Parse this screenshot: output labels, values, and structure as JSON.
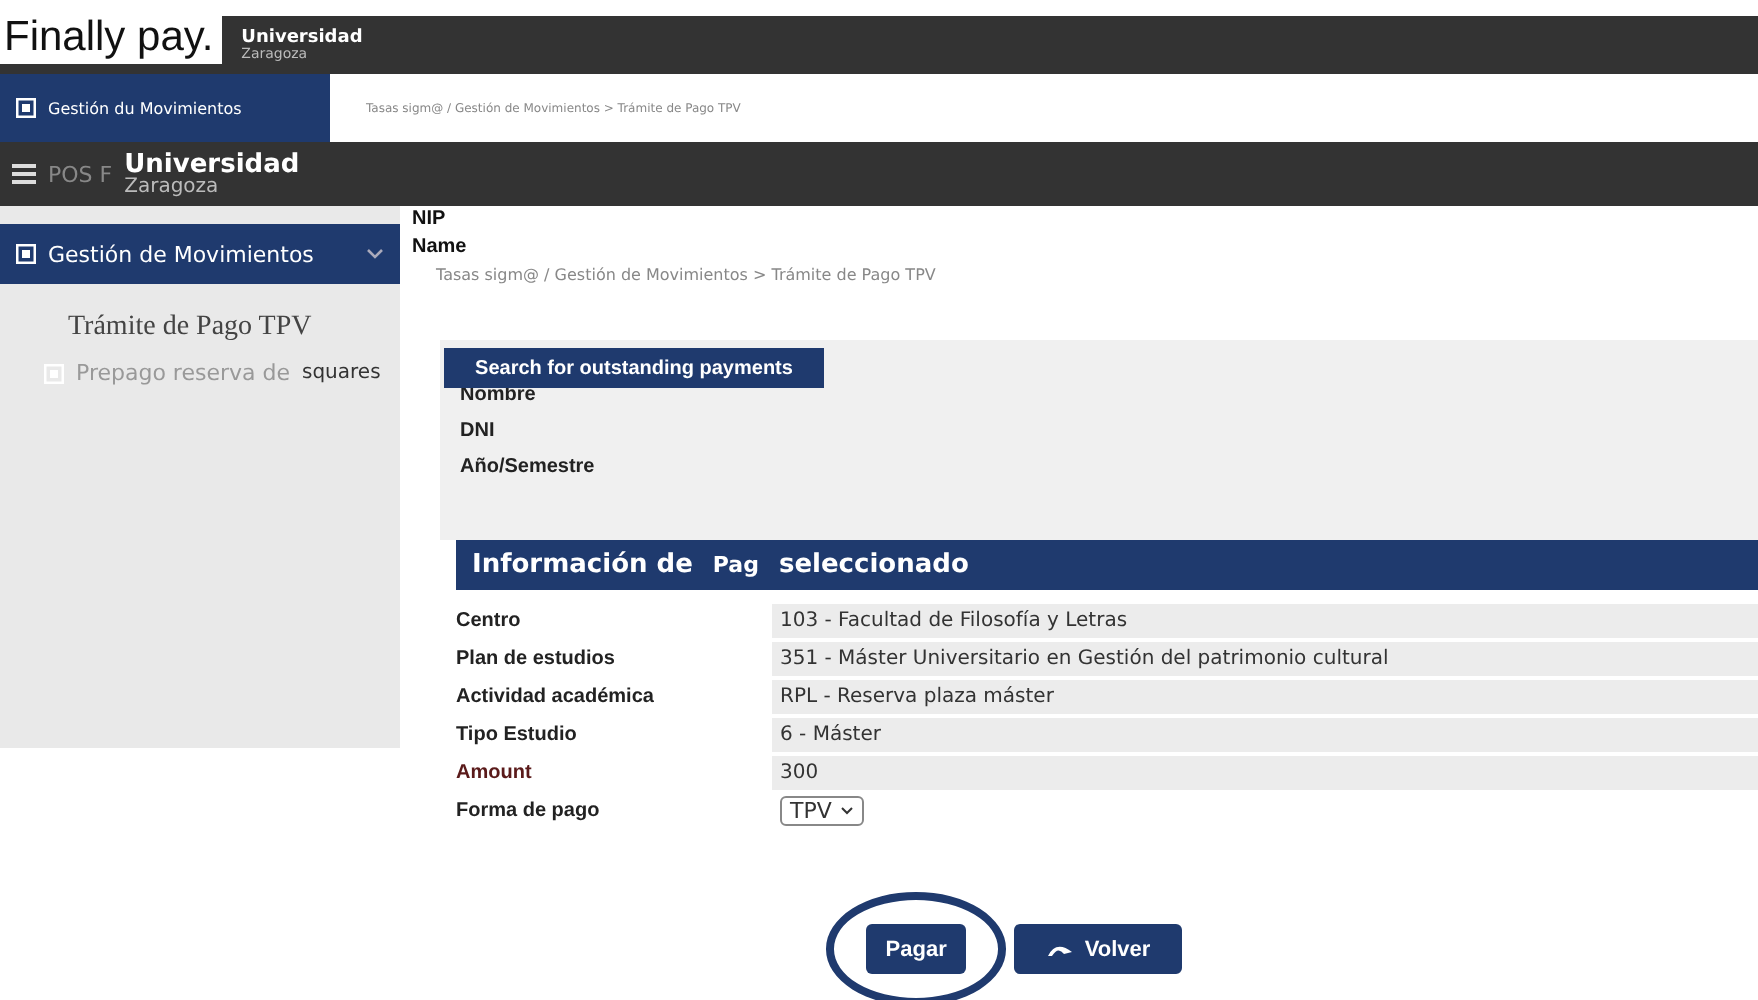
{
  "caption": "Finally pay.",
  "top_bar": {
    "logo_line_1": "Universidad",
    "logo_line_2": "Zaragoza"
  },
  "back_strip": {
    "menu_item": {
      "label": "Gestión du Movimientos",
      "selected": true
    },
    "breadcrumb": "Tasas sigm@ / Gestión de Movimientos > Trámite de Pago TPV"
  },
  "header": {
    "app_label": "POS F",
    "logo_line_1": "Universidad",
    "logo_line_2": "Zaragoza"
  },
  "overlay_labels": [
    "NIP",
    "Name"
  ],
  "sidebar": {
    "items": [
      {
        "label": "Gestión de Movimientos",
        "selected": true,
        "expanded": true,
        "children": [
          {
            "label": "Trámite de Pago TPV",
            "kind": "heading"
          },
          {
            "label": "Prepago reserva de",
            "kind": "link",
            "tag": "squares"
          }
        ]
      }
    ]
  },
  "breadcrumb": "Tasas sigm@ / Gestión de Movimientos > Trámite de Pago TPV",
  "search_panel": {
    "title": "Search for outstanding payments",
    "fields": [
      "Nombre",
      "DNI",
      "Año/Semestre"
    ]
  },
  "info_section": {
    "title_parts": [
      "Información de",
      "Pag",
      "seleccionado"
    ],
    "rows": [
      {
        "label": "Centro",
        "value": "103 - Facultad de Filosofía y Letras",
        "kind": "text"
      },
      {
        "label": "Plan de estudios",
        "value": "351 - Máster Universitario en Gestión del patrimonio cultural",
        "kind": "text"
      },
      {
        "label": "Actividad académica",
        "value": "RPL - Reserva plaza máster",
        "kind": "text"
      },
      {
        "label": "Tipo Estudio",
        "value": "6 - Máster",
        "kind": "text"
      },
      {
        "label": "Amount",
        "value": "300",
        "kind": "text"
      },
      {
        "label": "Forma de pago",
        "value": "TPV",
        "kind": "select"
      }
    ]
  },
  "buttons": [
    {
      "label": "Pagar",
      "kind": "primary",
      "highlighted": true
    },
    {
      "label": "Volver",
      "kind": "back",
      "highlighted": false
    }
  ]
}
